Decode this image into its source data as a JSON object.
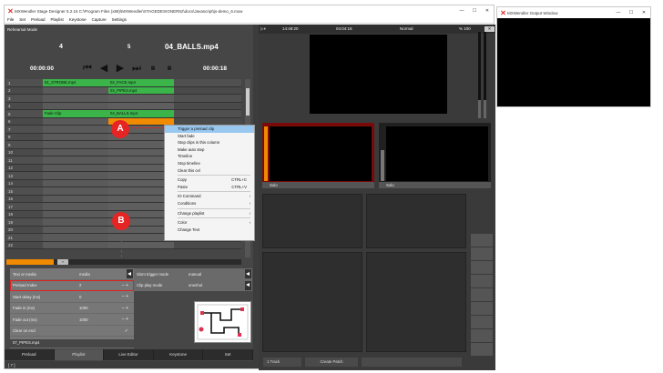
{
  "main_window": {
    "title": "MXWendler Stage Designer 5.2.16  C:\\Program Files (x86)\\MXWendler\\STAGEDESIGNER52\\docs\\Javascript\\js-demo_6.mxw",
    "controls": [
      "—",
      "☐",
      "✕"
    ]
  },
  "menu": [
    "File",
    "Set",
    "Preload",
    "Playlist",
    "Keystone",
    "Capture",
    "Settings"
  ],
  "left": {
    "mode": "Rehearsal Mode",
    "cue_left": "4",
    "cue_right": "5",
    "clip_name": "04_BALLS.mp4",
    "time_elapsed": "00:00:00",
    "time_total": "00:00:18",
    "transport": [
      "⏮",
      "◀",
      "▶",
      "⏭",
      "⏸",
      "⏸"
    ],
    "rows": [
      {
        "n": "1",
        "c1": "01_STROBE.mp4",
        "c2": "02_FACE.mp4"
      },
      {
        "n": "2",
        "c1": "",
        "c2": "03_PIPES.mp4"
      },
      {
        "n": "3",
        "c1": "",
        "c2": ""
      },
      {
        "n": "4",
        "c1": "",
        "c2": ""
      },
      {
        "n": "5",
        "c1": "Fade Clip",
        "c2": "04_BALLS.mp4"
      },
      {
        "n": "6",
        "c1": "",
        "c2": ""
      },
      {
        "n": "7",
        "c1": "",
        "c2": ""
      },
      {
        "n": "8",
        "c1": "",
        "c2": ""
      },
      {
        "n": "9",
        "c1": "",
        "c2": ""
      },
      {
        "n": "10",
        "c1": "",
        "c2": ""
      },
      {
        "n": "11",
        "c1": "",
        "c2": ""
      },
      {
        "n": "12",
        "c1": "",
        "c2": ""
      },
      {
        "n": "13",
        "c1": "",
        "c2": ""
      },
      {
        "n": "14",
        "c1": "",
        "c2": ""
      },
      {
        "n": "15",
        "c1": "",
        "c2": ""
      },
      {
        "n": "16",
        "c1": "",
        "c2": ""
      },
      {
        "n": "17",
        "c1": "",
        "c2": ""
      },
      {
        "n": "18",
        "c1": "",
        "c2": ""
      },
      {
        "n": "19",
        "c1": "",
        "c2": ""
      },
      {
        "n": "20",
        "c1": "",
        "c2": ""
      },
      {
        "n": "21",
        "c1": "",
        "c2": ""
      },
      {
        "n": "22",
        "c1": "",
        "c2": ""
      }
    ],
    "properties": [
      {
        "k": "Text or media",
        "v": "media",
        "pm": ""
      },
      {
        "k": "Preload Index",
        "v": "2",
        "pm": "– +"
      },
      {
        "k": "Start delay (ms)",
        "v": "0",
        "pm": "– +"
      },
      {
        "k": "Fade in (ms)",
        "v": "1000",
        "pm": "– +"
      },
      {
        "k": "Fade out (ms)",
        "v": "1000",
        "pm": "– +"
      },
      {
        "k": "Clear on end",
        "v": "",
        "pm": "✓"
      },
      {
        "k": "07_PIPES.mp4",
        "v": "",
        "pm": ""
      }
    ],
    "properties2": [
      {
        "k": "Slom trigger mode",
        "v": "manual"
      },
      {
        "k": "Clip play mode",
        "v": "oneshot"
      }
    ],
    "tabs": [
      "Preload",
      "Playlist",
      "Live Editor",
      "Keystone",
      "Set"
    ],
    "status": "[ 7 ]"
  },
  "badges": {
    "a": "A",
    "b": "B"
  },
  "context_menu": [
    {
      "label": "Trigger a preload clip",
      "shortcut": "",
      "arrow": ""
    },
    {
      "label": "Start fade",
      "shortcut": "",
      "arrow": ""
    },
    {
      "label": "Stop clips in this column",
      "shortcut": "",
      "arrow": ""
    },
    {
      "label": "Make auto step",
      "shortcut": "",
      "arrow": ""
    },
    {
      "label": "Timeline",
      "shortcut": "",
      "arrow": ""
    },
    {
      "label": "Stop timeline",
      "shortcut": "",
      "arrow": ""
    },
    {
      "label": "Clear this cel",
      "shortcut": "",
      "arrow": ""
    },
    {
      "sep": true
    },
    {
      "label": "Copy",
      "shortcut": "CTRL+C",
      "arrow": ""
    },
    {
      "label": "Paste",
      "shortcut": "CTRL+V",
      "arrow": ""
    },
    {
      "sep": true
    },
    {
      "label": "IO Command",
      "shortcut": "",
      "arrow": "›"
    },
    {
      "label": "Conditions",
      "shortcut": "",
      "arrow": "›"
    },
    {
      "sep": true
    },
    {
      "label": "Change playlist",
      "shortcut": "",
      "arrow": "›"
    },
    {
      "sep": true
    },
    {
      "label": "Color",
      "shortcut": "",
      "arrow": "›"
    },
    {
      "label": "Change Text",
      "shortcut": "",
      "arrow": ""
    }
  ],
  "right": {
    "timecode": "14:48:20",
    "time2": "04:04:18",
    "blend": "Normal",
    "percent": "% 100",
    "layer1_label": "Solo",
    "layer2_label": "Solo",
    "buttons": [
      "1 Track",
      "Create Patch",
      ""
    ]
  },
  "output_window": {
    "title": "MXWendler Output Window",
    "controls": [
      "—",
      "☐",
      "✕"
    ]
  },
  "colors": {
    "accent_orange": "#f08a00",
    "clip_green": "#3bb54a",
    "badge_red": "#e52424",
    "layer_red": "#7a0a0a"
  }
}
